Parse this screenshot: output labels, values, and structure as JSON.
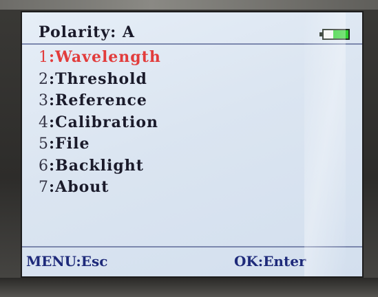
{
  "header": {
    "title": "Polarity: A",
    "battery_icon": "battery-icon",
    "battery_level": 0.65,
    "battery_color": "#2fd12f"
  },
  "menu": {
    "items": [
      {
        "num": "1",
        "label": ":Wavelength",
        "selected": true
      },
      {
        "num": "2",
        "label": ":Threshold",
        "selected": false
      },
      {
        "num": "3",
        "label": ":Reference",
        "selected": false
      },
      {
        "num": "4",
        "label": ":Calibration",
        "selected": false
      },
      {
        "num": "5",
        "label": ":File",
        "selected": false
      },
      {
        "num": "6",
        "label": ":Backlight",
        "selected": false
      },
      {
        "num": "7",
        "label": ":About",
        "selected": false
      }
    ]
  },
  "footer": {
    "left": "MENU:Esc",
    "right": "OK:Enter"
  },
  "colors": {
    "selected": "#e23c3c",
    "text": "#1a1a2a",
    "footer": "#1e2a7a",
    "screen": "#dbe5f1"
  }
}
